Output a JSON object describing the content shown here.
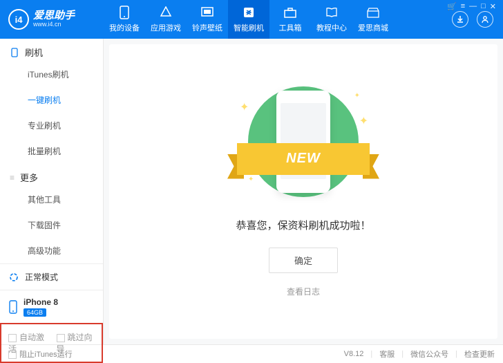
{
  "brand": {
    "name": "爱思助手",
    "url": "www.i4.cn",
    "logo_text": "i4"
  },
  "window_controls": {
    "cart": "⌄",
    "menu": "≡",
    "min": "—",
    "max": "□",
    "close": "✕"
  },
  "nav": [
    {
      "label": "我的设备"
    },
    {
      "label": "应用游戏"
    },
    {
      "label": "铃声壁纸"
    },
    {
      "label": "智能刷机",
      "active": true
    },
    {
      "label": "工具箱"
    },
    {
      "label": "教程中心"
    },
    {
      "label": "爱思商城"
    }
  ],
  "header_right": {
    "download": "↓",
    "user": "◯"
  },
  "sidebar": {
    "section1": {
      "title": "刷机",
      "items": [
        "iTunes刷机",
        "一键刷机",
        "专业刷机",
        "批量刷机"
      ],
      "active_index": 1
    },
    "section2": {
      "title": "更多",
      "items": [
        "其他工具",
        "下载固件",
        "高级功能"
      ]
    },
    "mode": "正常模式",
    "device": {
      "name": "iPhone 8",
      "storage": "64GB"
    },
    "checkboxes": {
      "cb1": "自动激活",
      "cb2": "跳过向导"
    }
  },
  "main": {
    "ribbon_text": "NEW",
    "success_text": "恭喜您，保资料刷机成功啦！",
    "confirm": "确定",
    "view_log": "查看日志"
  },
  "footer": {
    "left": "阻止iTunes运行",
    "version": "V8.12",
    "links": [
      "客服",
      "微信公众号",
      "检查更新"
    ]
  }
}
